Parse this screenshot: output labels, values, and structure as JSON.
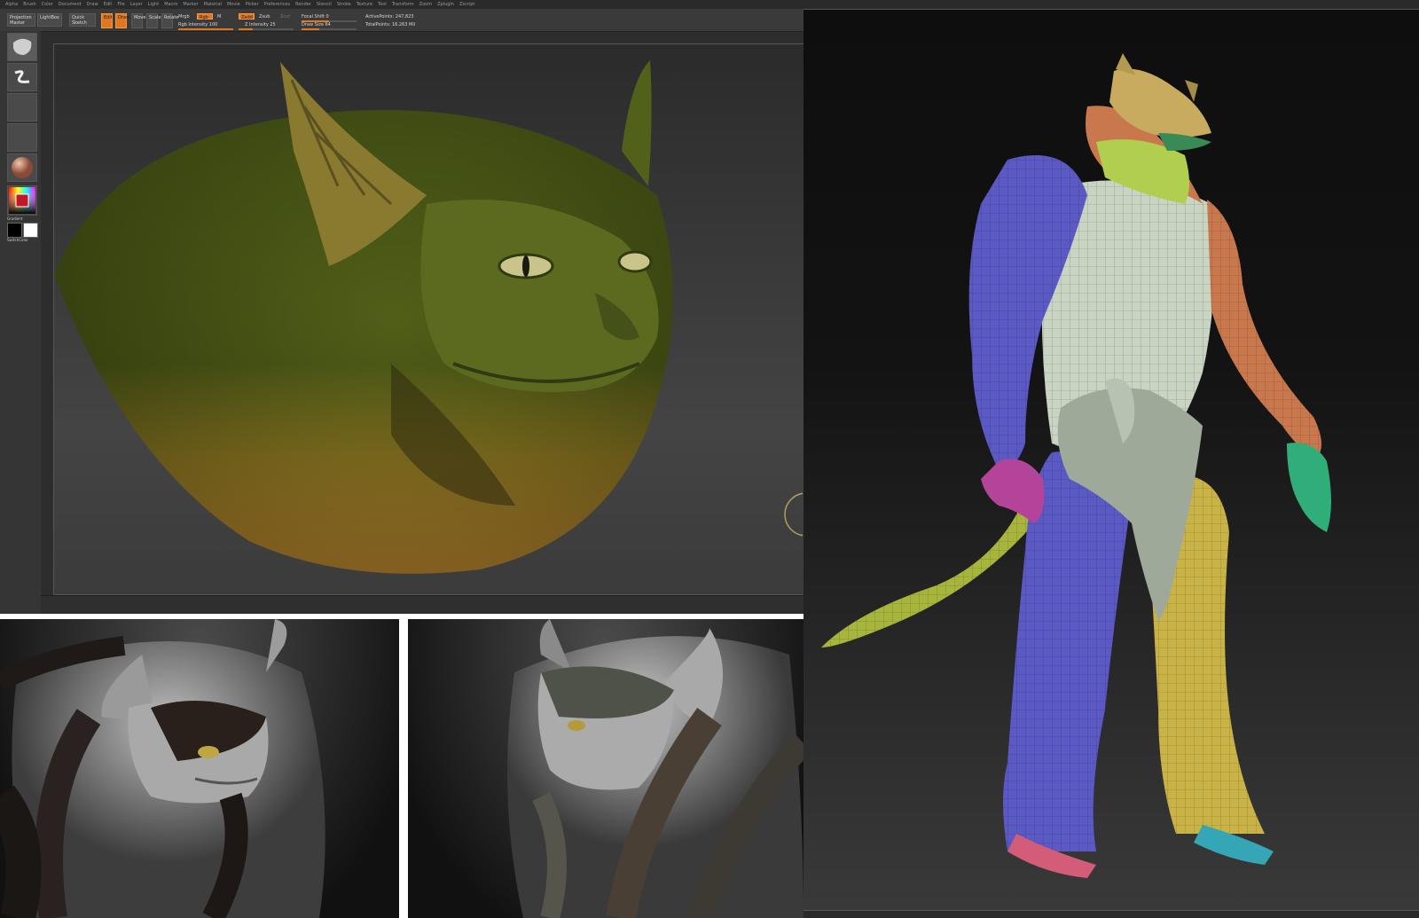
{
  "zbrush": {
    "menu": [
      "Alpha",
      "Brush",
      "Color",
      "Document",
      "Draw",
      "Edit",
      "File",
      "Layer",
      "Light",
      "Macro",
      "Marker",
      "Material",
      "Movie",
      "Picker",
      "Preferences",
      "Render",
      "Stencil",
      "Stroke",
      "Texture",
      "Tool",
      "Transform",
      "Zoom",
      "Zplugin",
      "Zscript"
    ],
    "shelf": {
      "projection_master": "Projection Master",
      "lightbox": "LightBox",
      "quick_sketch": "Quick Sketch",
      "edit": "Edit",
      "draw": "Draw",
      "move": "Move",
      "scale": "Scale",
      "rotate": "Rotate",
      "mrgb": "Mrgb",
      "rgb": "Rgb",
      "m": "M",
      "rgb_intensity": "Rgb Intensity 100",
      "zadd": "Zadd",
      "zsub": "Zsub",
      "zcut": "Zcut",
      "z_intensity": "Z Intensity 25",
      "focal_shift": "Focal Shift 0",
      "draw_size": "Draw Size 64",
      "active_points": "ActivePoints: 247,823",
      "total_points": "TotalPoints: 16.263 Mil"
    },
    "left": {
      "gradient": "Gradient",
      "switch_color": "SwitchColor"
    }
  },
  "colors": {
    "zbrush_orange": "#e0761f",
    "head_green": "#5b6a1c",
    "throat_orange": "#b9802a",
    "arm_blue": "#5a58c2",
    "torso_white": "#c9d4c4",
    "shoulder_orange": "#c9784e",
    "leg_yellow": "#c9b246",
    "tail_green": "#a3b43a",
    "sculpt_grey": "#a8a8a8"
  }
}
